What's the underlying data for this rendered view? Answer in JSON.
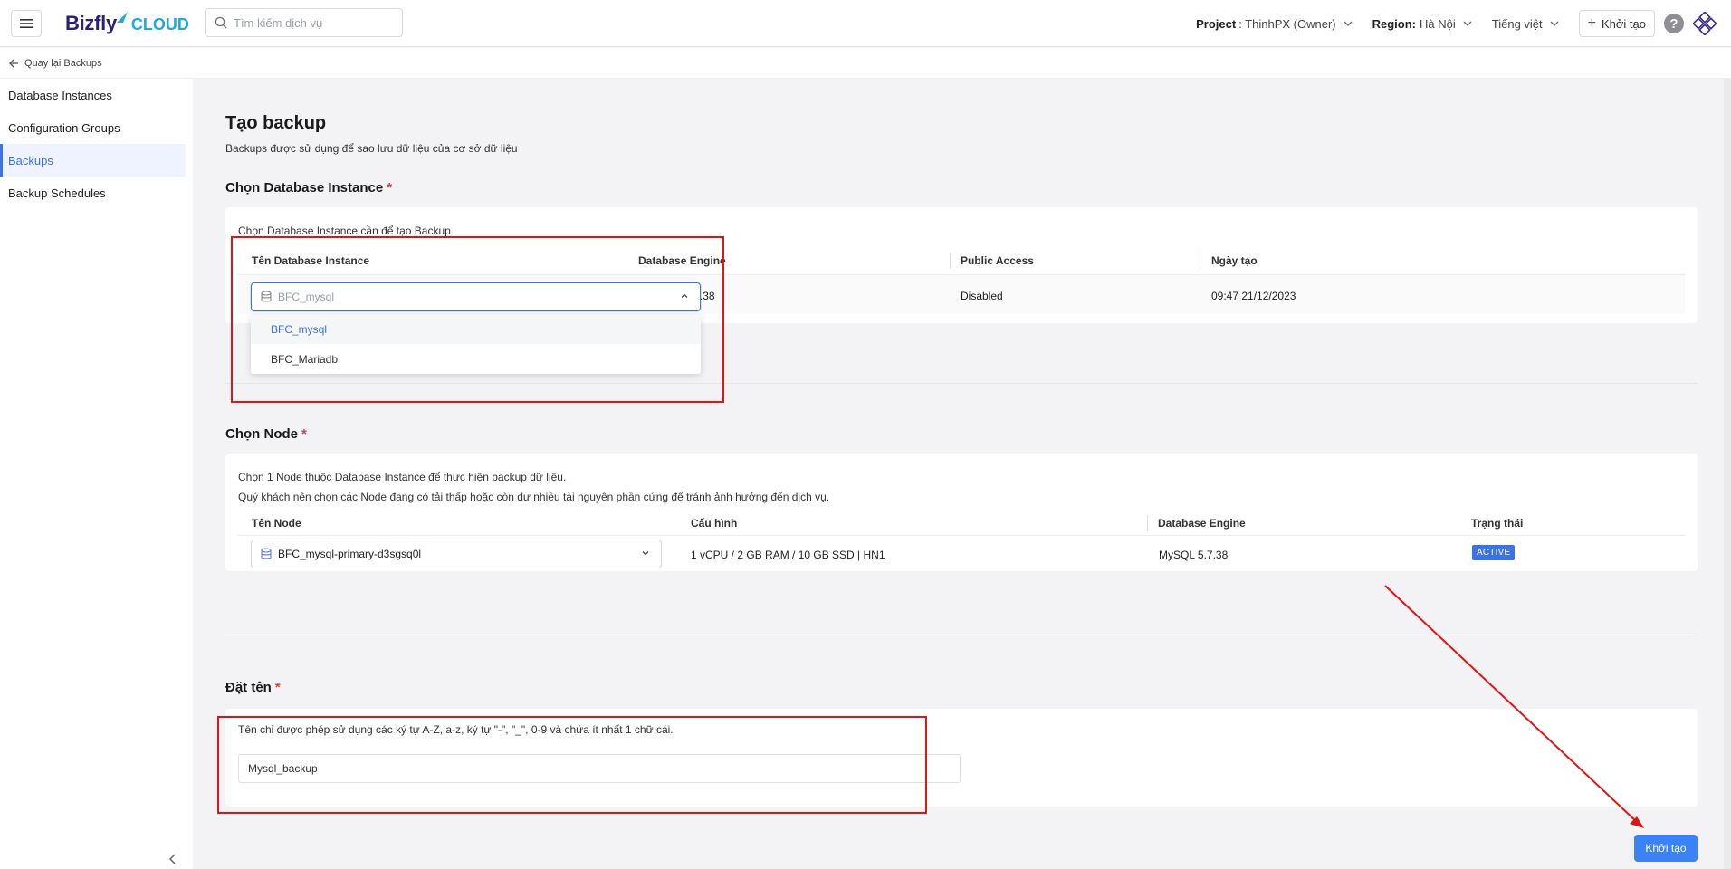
{
  "header": {
    "logo_main": "Bizfly",
    "logo_sub": "CLOUD",
    "search_placeholder": "Tìm kiếm dịch vụ",
    "project_label": "Project",
    "project_value": ": ThinhPX (Owner)",
    "region_label": "Region:",
    "region_value": "Hà Nội",
    "language": "Tiếng việt",
    "create_label": "Khởi tạo",
    "help": "?"
  },
  "backbar": {
    "label": "Quay lại Backups"
  },
  "sidebar": {
    "items": [
      {
        "label": "Database Instances",
        "active": false
      },
      {
        "label": "Configuration Groups",
        "active": false
      },
      {
        "label": "Backups",
        "active": true
      },
      {
        "label": "Backup Schedules",
        "active": false
      }
    ]
  },
  "page": {
    "title": "Tạo backup",
    "subtitle": "Backups được sử dụng để sao lưu dữ liệu của cơ sở dữ liệu"
  },
  "instance_section": {
    "title": "Chọn Database Instance",
    "required": "*",
    "note": "Chọn Database Instance cần để tạo Backup",
    "columns": [
      "Tên Database Instance",
      "Database Engine",
      "Public Access",
      "Ngày tạo"
    ],
    "select_placeholder": "BFC_mysql",
    "options": [
      "BFC_mysql",
      "BFC_Mariadb"
    ],
    "row": {
      "engine": "MySQL - 5.7.38",
      "public_access": "Disabled",
      "created": "09:47 21/12/2023"
    }
  },
  "node_section": {
    "title": "Chọn Node",
    "required": "*",
    "note1": "Chọn 1 Node thuộc Database Instance để thực hiện backup dữ liệu.",
    "note2": "Quý khách nên chọn các Node đang có tải thấp hoặc còn dư nhiều tài nguyên phần cứng để tránh ảnh hưởng đến dịch vụ.",
    "columns": [
      "Tên Node",
      "Cấu hình",
      "Database Engine",
      "Trạng thái"
    ],
    "row": {
      "node": "BFC_mysql-primary-d3sgsq0l",
      "config": "1 vCPU / 2 GB RAM / 10 GB SSD | HN1",
      "engine": "MySQL 5.7.38",
      "status": "ACTIVE"
    }
  },
  "name_section": {
    "title": "Đặt tên",
    "required": "*",
    "note": "Tên chỉ được phép sử dụng các ký tự A-Z, a-z, ký tự \"-\", \"_\", 0-9 và chứa ít nhất 1 chữ cái.",
    "value": "Mysql_backup"
  },
  "submit_label": "Khởi tạo",
  "colors": {
    "accent": "#3b73e6",
    "annotation": "#e01414"
  }
}
